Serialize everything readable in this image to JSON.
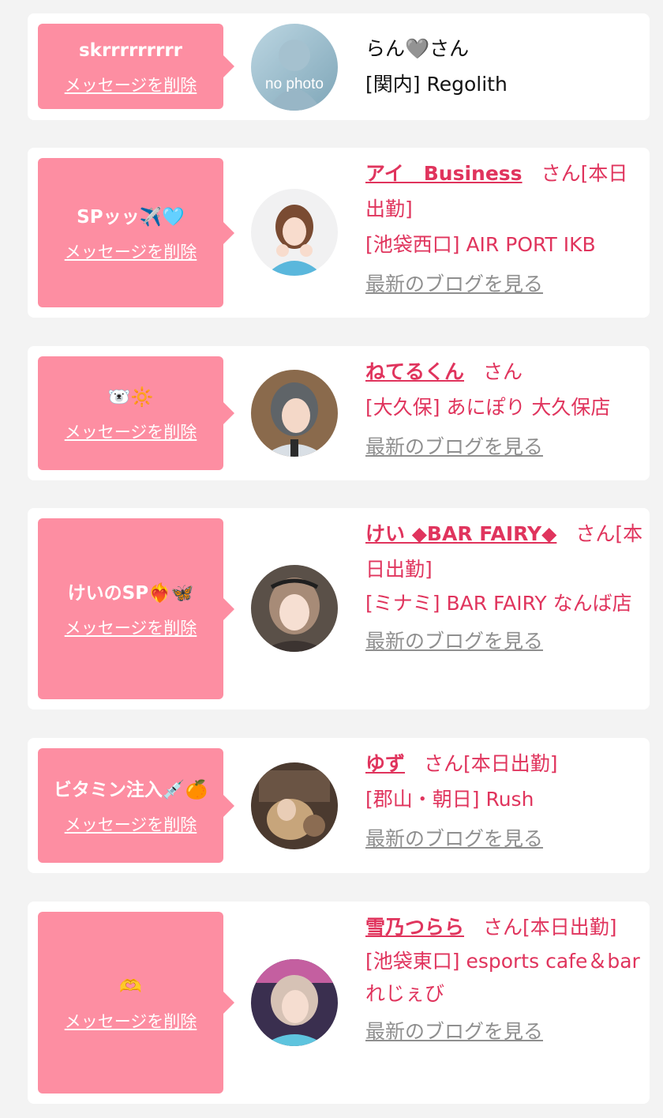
{
  "delete_label": "メッセージを削除",
  "blog_label": "最新のブログを見る",
  "colors": {
    "page_background": "#f3f3f3",
    "card_background": "#ffffff",
    "bubble_pink": "#fd8ea2",
    "accent_red": "#e0345d",
    "link_gray": "#8f8f8f"
  },
  "entries": [
    {
      "message": "skrrrrrrrrr",
      "name": "らん🩶さん",
      "name_is_link": false,
      "area": "[関内] Regolith",
      "avatar": {
        "type": "no-photo",
        "text": "no photo"
      },
      "has_blog": false
    },
    {
      "message": "SPッッ✈️🩵",
      "name": "アイ　Business",
      "san": "さん[本日出勤]",
      "name_is_link": true,
      "area": "[池袋西口] AIR PORT IKB",
      "avatar": {
        "type": "photo"
      },
      "has_blog": true
    },
    {
      "message": "🐻‍❄️🔆",
      "name": "ねてるくん",
      "san": "さん",
      "name_is_link": true,
      "area": "[大久保] あにぽり 大久保店",
      "avatar": {
        "type": "photo"
      },
      "has_blog": true
    },
    {
      "message": "けいのSP❤️‍🔥🦋",
      "name": "けい ◆BAR FAIRY◆",
      "san": "さん[本日出勤]",
      "name_is_link": true,
      "area": "[ミナミ] BAR FAIRY なんば店",
      "avatar": {
        "type": "photo"
      },
      "has_blog": true
    },
    {
      "message": "ビタミン注入💉🍊",
      "name": "ゆず",
      "san": "さん[本日出勤]",
      "name_is_link": true,
      "area": "[郡山・朝日] Rush",
      "avatar": {
        "type": "photo"
      },
      "has_blog": true
    },
    {
      "message": "🫶",
      "name": "雪乃つらら",
      "san": "さん[本日出勤]",
      "name_is_link": true,
      "area": "[池袋東口] esports cafe＆bar れじぇび",
      "avatar": {
        "type": "photo"
      },
      "has_blog": true
    }
  ]
}
